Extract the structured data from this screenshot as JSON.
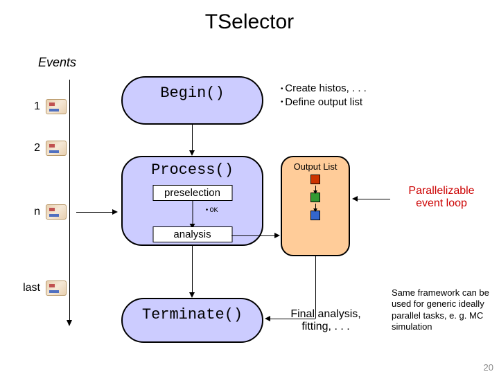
{
  "title": "TSelector",
  "events_heading": "Events",
  "event_labels": {
    "e1": "1",
    "e2": "2",
    "en": "n",
    "elast": "last"
  },
  "stages": {
    "begin": "Begin()",
    "process": "Process()",
    "terminate": "Terminate()",
    "preselection": "preselection",
    "analysis": "analysis",
    "ok": "OK"
  },
  "begin_bullets": {
    "b1": "Create histos, . . .",
    "b2": "Define output list"
  },
  "output_list": {
    "title": "Output List"
  },
  "parallel": {
    "l1": "Parallelizable",
    "l2": "event loop"
  },
  "final": {
    "l1": "Final analysis,",
    "l2": "fitting, . . ."
  },
  "note": "Same framework can be used for generic ideally parallel tasks, e. g. MC simulation",
  "page_number": "20"
}
